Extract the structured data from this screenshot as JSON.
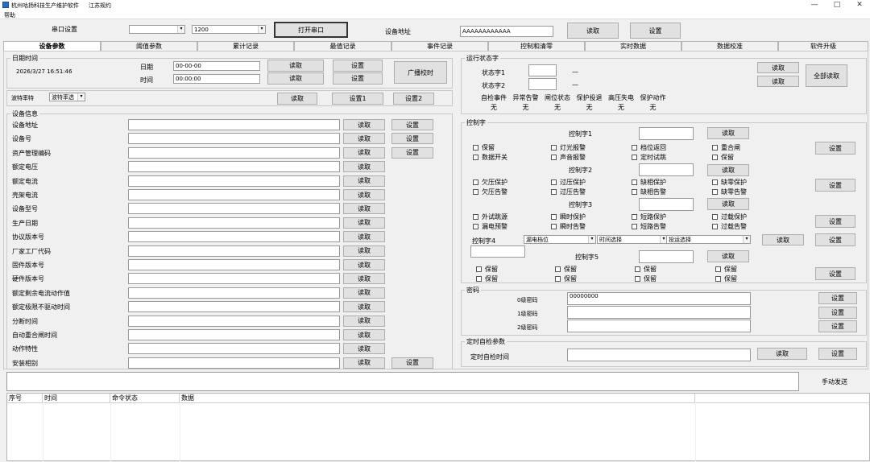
{
  "window": {
    "title": "杭州咕扬科技生产维护软件",
    "region": "江苏规约",
    "controls": {
      "min": "—",
      "max": "□",
      "close": "✕"
    }
  },
  "menu": {
    "help": "帮助"
  },
  "serial": {
    "label": "串口设置",
    "port": "",
    "baud": "1200",
    "open_button": "打开串口",
    "addr_label": "设备地址",
    "addr_value": "AAAAAAAAAAAA",
    "read": "读取",
    "set": "设置"
  },
  "tabs": [
    "设备参数",
    "阈值参数",
    "累计记录",
    "最值记录",
    "事件记录",
    "控制和清零",
    "实时数据",
    "数据校准",
    "软件升级"
  ],
  "datetime": {
    "title": "日期时间",
    "now": "2026/3/27 16:51:46",
    "date_label": "日期",
    "date_value": "00-00-00",
    "time_label": "时间",
    "time_value": "00:00:00",
    "read": "读取",
    "set": "设置",
    "broadcast": "广播校时"
  },
  "baud": {
    "label": "波特率特",
    "select": "波特率选",
    "read": "读取",
    "set1": "设置1",
    "set2": "设置2"
  },
  "device_info": {
    "title": "设备信息",
    "read": "读取",
    "set": "设置",
    "fields": [
      "设备地址",
      "设备号",
      "资产管理编码",
      "额定电压",
      "额定电流",
      "壳架电流",
      "设备型号",
      "生产日期",
      "协议版本号",
      "厂家工厂代码",
      "固件版本号",
      "硬件版本号",
      "额定剩余电流动作值",
      "额定极限不驱动时间",
      "分断时间",
      "自动重合闸时间",
      "动作特性",
      "安装相别"
    ]
  },
  "run_status": {
    "title": "运行状态字",
    "word1": "状态字1",
    "word2": "状态字2",
    "dash": "—",
    "read": "读取",
    "read_all": "全部读取",
    "items": [
      "自检事件",
      "异常告警",
      "闸位状态",
      "保护投退",
      "高压失电",
      "保护动作"
    ],
    "values": [
      "无",
      "无",
      "无",
      "无",
      "无",
      "无"
    ]
  },
  "control": {
    "title": "控制字",
    "w1": "控制字1",
    "w2": "控制字2",
    "w3": "控制字3",
    "w4": "控制字4",
    "w5": "控制字5",
    "read": "读取",
    "set": "设置",
    "cb1": [
      "保留",
      "灯光报警",
      "档位返回",
      "重合闸",
      "数据开关",
      "声音报警",
      "定时试跳",
      "保留"
    ],
    "cb2": [
      "欠压保护",
      "过压保护",
      "缺相保护",
      "缺零保护",
      "欠压告警",
      "过压告警",
      "缺相告警",
      "缺零告警"
    ],
    "cb3": [
      "外试跳源",
      "瞬时保护",
      "短路保护",
      "过载保护",
      "漏电预警",
      "瞬时告警",
      "短路告警",
      "过载告警"
    ],
    "sel_leak": "漏电档位",
    "sel_time": "时间选择",
    "sel_cast": "投运选择",
    "cb5": [
      "保留",
      "保留",
      "保留",
      "保留",
      "保留",
      "保留",
      "保留",
      "保留"
    ]
  },
  "password": {
    "title": "密码",
    "l0": "0级密码",
    "l1": "1级密码",
    "l2": "2级密码",
    "v0": "00000000",
    "set": "设置"
  },
  "selfcheck": {
    "title": "定时自检参数",
    "label": "定时自检时间",
    "read": "读取",
    "set": "设置"
  },
  "send": {
    "button": "手动发送"
  },
  "log": {
    "columns": [
      "序号",
      "时间",
      "命令状态",
      "数据"
    ]
  }
}
